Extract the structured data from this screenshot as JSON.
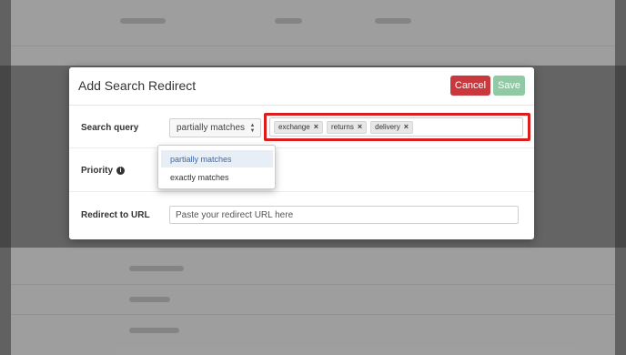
{
  "modal": {
    "title": "Add Search Redirect",
    "cancel_label": "Cancel",
    "save_label": "Save"
  },
  "search_query": {
    "label": "Search query",
    "match_type": "partially matches",
    "tags": [
      {
        "label": "exchange",
        "remove": "×"
      },
      {
        "label": "returns",
        "remove": "×"
      },
      {
        "label": "delivery",
        "remove": "×"
      }
    ]
  },
  "match_dropdown": {
    "options": [
      "partially matches",
      "exactly matches"
    ],
    "selected": "partially matches"
  },
  "priority": {
    "label": "Priority",
    "info_icon": "info-circle-icon"
  },
  "redirect_url": {
    "label": "Redirect to URL",
    "placeholder": "Paste your redirect URL here"
  },
  "colors": {
    "cancel": "#c9383c",
    "save": "#8fcaa4",
    "highlight": "#dd1c1c",
    "dropdown_active": "#3b6aa8"
  }
}
